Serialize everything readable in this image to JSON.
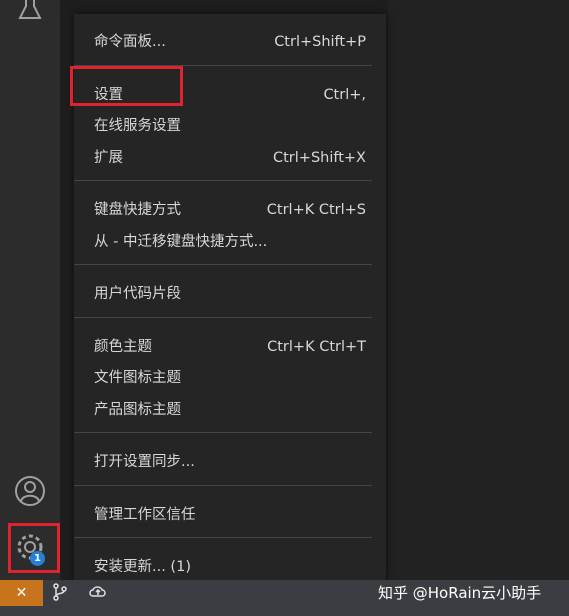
{
  "menu": {
    "groups": [
      [
        {
          "label": "命令面板...",
          "shortcut": "Ctrl+Shift+P"
        }
      ],
      [
        {
          "label": "设置",
          "shortcut": "Ctrl+,"
        },
        {
          "label": "在线服务设置",
          "shortcut": ""
        },
        {
          "label": "扩展",
          "shortcut": "Ctrl+Shift+X"
        }
      ],
      [
        {
          "label": "键盘快捷方式",
          "shortcut": "Ctrl+K Ctrl+S"
        },
        {
          "label": "从 - 中迁移键盘快捷方式...",
          "shortcut": ""
        }
      ],
      [
        {
          "label": "用户代码片段",
          "shortcut": ""
        }
      ],
      [
        {
          "label": "颜色主题",
          "shortcut": "Ctrl+K Ctrl+T"
        },
        {
          "label": "文件图标主题",
          "shortcut": ""
        },
        {
          "label": "产品图标主题",
          "shortcut": ""
        }
      ],
      [
        {
          "label": "打开设置同步...",
          "shortcut": ""
        }
      ],
      [
        {
          "label": "管理工作区信任",
          "shortcut": ""
        }
      ],
      [
        {
          "label": "安装更新... (1)",
          "shortcut": ""
        }
      ]
    ]
  },
  "activity": {
    "manage_badge": "1",
    "icons": [
      "flask-icon",
      "account-icon",
      "gear-icon"
    ]
  },
  "statusbar": {
    "icons": [
      "remote-icon",
      "source-control-icon",
      "cloud-sync-icon"
    ]
  },
  "watermark": "知乎 @HoRain云小助手",
  "colors": {
    "highlight": "#e0232e",
    "badge": "#2680d4",
    "remote": "#c8741c"
  }
}
